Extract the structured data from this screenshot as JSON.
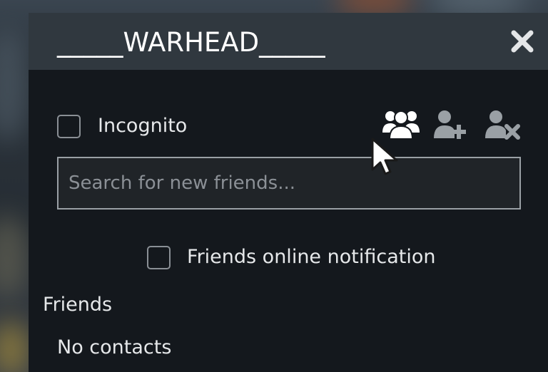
{
  "window": {
    "title": "_____WARHEAD_____",
    "close_icon": "close-icon"
  },
  "controls": {
    "incognito_label": "Incognito",
    "incognito_checked": false,
    "icons": [
      "friends-group-icon",
      "add-friend-icon",
      "remove-friend-icon"
    ]
  },
  "search": {
    "placeholder": "Search for new friends...",
    "value": ""
  },
  "notification": {
    "label": "Friends online notification",
    "checked": false
  },
  "friends": {
    "heading": "Friends",
    "empty_text": "No contacts"
  },
  "colors": {
    "panel_bg": "#14181d",
    "titlebar_bg": "#30383f",
    "text": "#e6e8ea",
    "icon_active": "#ffffff",
    "icon_inactive": "#9aa0a5"
  }
}
